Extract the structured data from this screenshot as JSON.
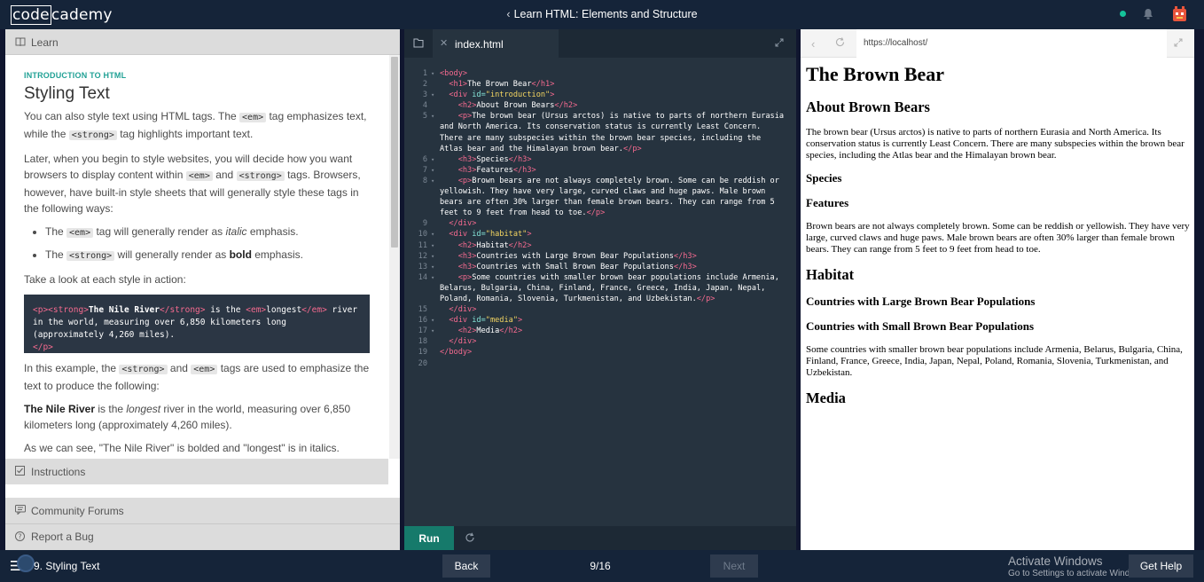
{
  "topbar": {
    "logo_part1": "code",
    "logo_part2": "cademy",
    "course_title": "Learn HTML: Elements and Structure",
    "colors": {
      "status_dot": "#15c39a",
      "background": "#152439"
    }
  },
  "learn_panel": {
    "header": "Learn",
    "kicker": "INTRODUCTION TO HTML",
    "title": "Styling Text",
    "p1": {
      "a": "You can also style text using HTML tags. The ",
      "code1": "<em>",
      "b": " tag emphasizes text, while the ",
      "code2": "<strong>",
      "c": " tag highlights important text."
    },
    "p2": {
      "a": "Later, when you begin to style websites, you will decide how you want browsers to display content within ",
      "code1": "<em>",
      "b": " and ",
      "code2": "<strong>",
      "c": " tags. Browsers, however, have built-in style sheets that will generally style these tags in the following ways:"
    },
    "bullets": [
      {
        "a": "The ",
        "code": "<em>",
        "b": " tag will generally render as ",
        "styled": "italic",
        "c": " emphasis."
      },
      {
        "a": "The ",
        "code": "<strong>",
        "b": " will generally render as ",
        "styled": "bold",
        "c": " emphasis."
      }
    ],
    "p3": "Take a look at each style in action:",
    "example_code": {
      "t1": "<p><strong>",
      "s1": "The Nile River",
      "t2": "</strong>",
      "s2": " is the ",
      "t3": "<em>",
      "s3": "longest",
      "t4": "</em>",
      "s4": " river in the world, measuring over 6,850 kilometers long (approximately 4,260 miles).",
      "t5": "</p>"
    },
    "p4": {
      "a": "In this example, the ",
      "code1": "<strong>",
      "b": " and ",
      "code2": "<em>",
      "c": " tags are used to emphasize the text to produce the following:"
    },
    "p5": {
      "bold": "The Nile River",
      "a": " is the ",
      "italic": "longest",
      "b": " river in the world, measuring over 6,850 kilometers long (approximately 4,260 miles)."
    },
    "p6": "As we can see, \"The Nile River\" is bolded and \"longest\" is in italics.",
    "instructions": "Instructions",
    "community_forums": "Community Forums",
    "report_bug": "Report a Bug"
  },
  "editor": {
    "file_tab": "index.html",
    "run_label": "Run",
    "lines": [
      {
        "n": "1",
        "fold": true,
        "html": "<span class='t'>&lt;body&gt;</span>"
      },
      {
        "n": "2",
        "fold": false,
        "html": "  <span class='t'>&lt;h1&gt;</span>The Brown Bear<span class='t'>&lt;/h1&gt;</span>"
      },
      {
        "n": "3",
        "fold": true,
        "html": "  <span class='t'>&lt;div</span> <span class='a'>id=</span><span class='s'>\"introduction\"</span><span class='t'>&gt;</span>"
      },
      {
        "n": "4",
        "fold": false,
        "html": "    <span class='t'>&lt;h2&gt;</span>About Brown Bears<span class='t'>&lt;/h2&gt;</span>"
      },
      {
        "n": "5",
        "fold": true,
        "html": "    <span class='t'>&lt;p&gt;</span>The brown bear (Ursus arctos) is native to parts of northern Eurasia and North America. Its conservation status is currently Least Concern. There are many subspecies within the brown bear species, including the Atlas bear and the Himalayan brown bear.<span class='t'>&lt;/p&gt;</span>"
      },
      {
        "n": "6",
        "fold": true,
        "html": "    <span class='t'>&lt;h3&gt;</span>Species<span class='t'>&lt;/h3&gt;</span>"
      },
      {
        "n": "7",
        "fold": true,
        "html": "    <span class='t'>&lt;h3&gt;</span>Features<span class='t'>&lt;/h3&gt;</span>"
      },
      {
        "n": "8",
        "fold": true,
        "html": "    <span class='t'>&lt;p&gt;</span>Brown bears are not always completely brown. Some can be reddish or yellowish. They have very large, curved claws and huge paws. Male brown bears are often 30% larger than female brown bears. They can range from 5 feet to 9 feet from head to toe.<span class='t'>&lt;/p&gt;</span>"
      },
      {
        "n": "9",
        "fold": false,
        "html": "  <span class='t'>&lt;/div&gt;</span>"
      },
      {
        "n": "10",
        "fold": true,
        "html": "  <span class='t'>&lt;div</span> <span class='a'>id=</span><span class='s'>\"habitat\"</span><span class='t'>&gt;</span>"
      },
      {
        "n": "11",
        "fold": true,
        "html": "    <span class='t'>&lt;h2&gt;</span>Habitat<span class='t'>&lt;/h2&gt;</span>"
      },
      {
        "n": "12",
        "fold": true,
        "html": "    <span class='t'>&lt;h3&gt;</span>Countries with Large Brown Bear Populations<span class='t'>&lt;/h3&gt;</span>"
      },
      {
        "n": "13",
        "fold": true,
        "html": "    <span class='t'>&lt;h3&gt;</span>Countries with Small Brown Bear Populations<span class='t'>&lt;/h3&gt;</span>"
      },
      {
        "n": "14",
        "fold": true,
        "html": "    <span class='t'>&lt;p&gt;</span>Some countries with smaller brown bear populations include Armenia, Belarus, Bulgaria, China, Finland, France, Greece, India, Japan, Nepal, Poland, Romania, Slovenia, Turkmenistan, and Uzbekistan.<span class='t'>&lt;/p&gt;</span>"
      },
      {
        "n": "15",
        "fold": false,
        "html": "  <span class='t'>&lt;/div&gt;</span>"
      },
      {
        "n": "16",
        "fold": true,
        "html": "  <span class='t'>&lt;div</span> <span class='a'>id=</span><span class='s'>\"media\"</span><span class='t'>&gt;</span>"
      },
      {
        "n": "17",
        "fold": true,
        "html": "    <span class='t'>&lt;h2&gt;</span>Media<span class='t'>&lt;/h2&gt;</span>"
      },
      {
        "n": "18",
        "fold": false,
        "html": "  <span class='t'>&lt;/div&gt;</span>"
      },
      {
        "n": "19",
        "fold": false,
        "html": "<span class='t'>&lt;/body&gt;</span>"
      },
      {
        "n": "20",
        "fold": false,
        "html": ""
      }
    ],
    "colors": {
      "background": "#26333f",
      "tag": "#f56a8f",
      "attr": "#84e2d6",
      "string": "#f3d561",
      "run": "#167a6b"
    }
  },
  "browser": {
    "url": "https://localhost/",
    "page": {
      "h1": "The Brown Bear",
      "h2_about": "About Brown Bears",
      "p_about": "The brown bear (Ursus arctos) is native to parts of northern Eurasia and North America. Its conservation status is currently Least Concern. There are many subspecies within the brown bear species, including the Atlas bear and the Himalayan brown bear.",
      "h3_species": "Species",
      "h3_features": "Features",
      "p_features": "Brown bears are not always completely brown. Some can be reddish or yellowish. They have very large, curved claws and huge paws. Male brown bears are often 30% larger than female brown bears. They can range from 5 feet to 9 feet from head to toe.",
      "h2_habitat": "Habitat",
      "h3_large": "Countries with Large Brown Bear Populations",
      "h3_small": "Countries with Small Brown Bear Populations",
      "p_habitat": "Some countries with smaller brown bear populations include Armenia, Belarus, Bulgaria, China, Finland, France, Greece, India, Japan, Nepal, Poland, Romania, Slovenia, Turkmenistan, and Uzbekistan.",
      "h2_media": "Media"
    }
  },
  "bottombar": {
    "lesson_name": "9. Styling Text",
    "back_label": "Back",
    "progress": "9/16",
    "next_label": "Next",
    "activate_title": "Activate Windows",
    "activate_sub": "Go to Settings to activate Windows.",
    "help_label": "Get Help"
  }
}
